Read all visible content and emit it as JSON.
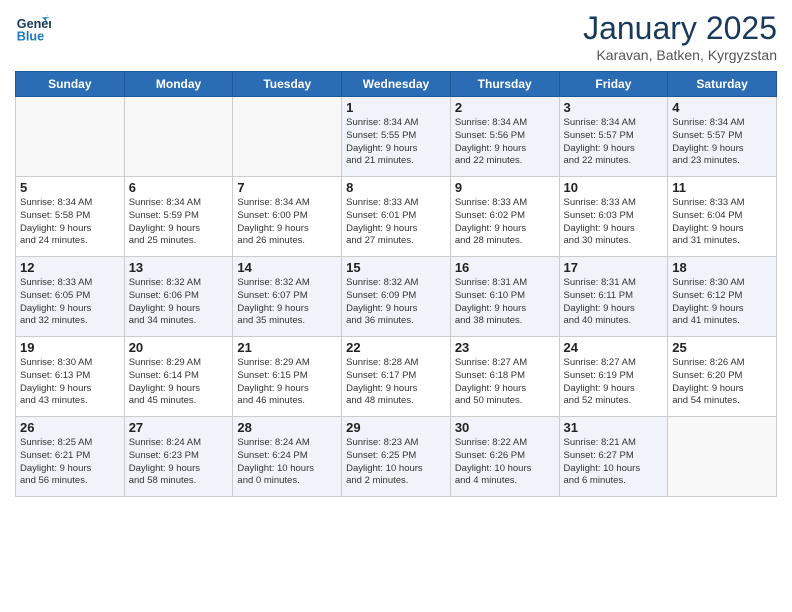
{
  "header": {
    "title": "January 2025",
    "location": "Karavan, Batken, Kyrgyzstan",
    "logo_line1": "General",
    "logo_line2": "Blue"
  },
  "weekdays": [
    "Sunday",
    "Monday",
    "Tuesday",
    "Wednesday",
    "Thursday",
    "Friday",
    "Saturday"
  ],
  "weeks": [
    [
      {
        "day": "",
        "content": ""
      },
      {
        "day": "",
        "content": ""
      },
      {
        "day": "",
        "content": ""
      },
      {
        "day": "1",
        "content": "Sunrise: 8:34 AM\nSunset: 5:55 PM\nDaylight: 9 hours\nand 21 minutes."
      },
      {
        "day": "2",
        "content": "Sunrise: 8:34 AM\nSunset: 5:56 PM\nDaylight: 9 hours\nand 22 minutes."
      },
      {
        "day": "3",
        "content": "Sunrise: 8:34 AM\nSunset: 5:57 PM\nDaylight: 9 hours\nand 22 minutes."
      },
      {
        "day": "4",
        "content": "Sunrise: 8:34 AM\nSunset: 5:57 PM\nDaylight: 9 hours\nand 23 minutes."
      }
    ],
    [
      {
        "day": "5",
        "content": "Sunrise: 8:34 AM\nSunset: 5:58 PM\nDaylight: 9 hours\nand 24 minutes."
      },
      {
        "day": "6",
        "content": "Sunrise: 8:34 AM\nSunset: 5:59 PM\nDaylight: 9 hours\nand 25 minutes."
      },
      {
        "day": "7",
        "content": "Sunrise: 8:34 AM\nSunset: 6:00 PM\nDaylight: 9 hours\nand 26 minutes."
      },
      {
        "day": "8",
        "content": "Sunrise: 8:33 AM\nSunset: 6:01 PM\nDaylight: 9 hours\nand 27 minutes."
      },
      {
        "day": "9",
        "content": "Sunrise: 8:33 AM\nSunset: 6:02 PM\nDaylight: 9 hours\nand 28 minutes."
      },
      {
        "day": "10",
        "content": "Sunrise: 8:33 AM\nSunset: 6:03 PM\nDaylight: 9 hours\nand 30 minutes."
      },
      {
        "day": "11",
        "content": "Sunrise: 8:33 AM\nSunset: 6:04 PM\nDaylight: 9 hours\nand 31 minutes."
      }
    ],
    [
      {
        "day": "12",
        "content": "Sunrise: 8:33 AM\nSunset: 6:05 PM\nDaylight: 9 hours\nand 32 minutes."
      },
      {
        "day": "13",
        "content": "Sunrise: 8:32 AM\nSunset: 6:06 PM\nDaylight: 9 hours\nand 34 minutes."
      },
      {
        "day": "14",
        "content": "Sunrise: 8:32 AM\nSunset: 6:07 PM\nDaylight: 9 hours\nand 35 minutes."
      },
      {
        "day": "15",
        "content": "Sunrise: 8:32 AM\nSunset: 6:09 PM\nDaylight: 9 hours\nand 36 minutes."
      },
      {
        "day": "16",
        "content": "Sunrise: 8:31 AM\nSunset: 6:10 PM\nDaylight: 9 hours\nand 38 minutes."
      },
      {
        "day": "17",
        "content": "Sunrise: 8:31 AM\nSunset: 6:11 PM\nDaylight: 9 hours\nand 40 minutes."
      },
      {
        "day": "18",
        "content": "Sunrise: 8:30 AM\nSunset: 6:12 PM\nDaylight: 9 hours\nand 41 minutes."
      }
    ],
    [
      {
        "day": "19",
        "content": "Sunrise: 8:30 AM\nSunset: 6:13 PM\nDaylight: 9 hours\nand 43 minutes."
      },
      {
        "day": "20",
        "content": "Sunrise: 8:29 AM\nSunset: 6:14 PM\nDaylight: 9 hours\nand 45 minutes."
      },
      {
        "day": "21",
        "content": "Sunrise: 8:29 AM\nSunset: 6:15 PM\nDaylight: 9 hours\nand 46 minutes."
      },
      {
        "day": "22",
        "content": "Sunrise: 8:28 AM\nSunset: 6:17 PM\nDaylight: 9 hours\nand 48 minutes."
      },
      {
        "day": "23",
        "content": "Sunrise: 8:27 AM\nSunset: 6:18 PM\nDaylight: 9 hours\nand 50 minutes."
      },
      {
        "day": "24",
        "content": "Sunrise: 8:27 AM\nSunset: 6:19 PM\nDaylight: 9 hours\nand 52 minutes."
      },
      {
        "day": "25",
        "content": "Sunrise: 8:26 AM\nSunset: 6:20 PM\nDaylight: 9 hours\nand 54 minutes."
      }
    ],
    [
      {
        "day": "26",
        "content": "Sunrise: 8:25 AM\nSunset: 6:21 PM\nDaylight: 9 hours\nand 56 minutes."
      },
      {
        "day": "27",
        "content": "Sunrise: 8:24 AM\nSunset: 6:23 PM\nDaylight: 9 hours\nand 58 minutes."
      },
      {
        "day": "28",
        "content": "Sunrise: 8:24 AM\nSunset: 6:24 PM\nDaylight: 10 hours\nand 0 minutes."
      },
      {
        "day": "29",
        "content": "Sunrise: 8:23 AM\nSunset: 6:25 PM\nDaylight: 10 hours\nand 2 minutes."
      },
      {
        "day": "30",
        "content": "Sunrise: 8:22 AM\nSunset: 6:26 PM\nDaylight: 10 hours\nand 4 minutes."
      },
      {
        "day": "31",
        "content": "Sunrise: 8:21 AM\nSunset: 6:27 PM\nDaylight: 10 hours\nand 6 minutes."
      },
      {
        "day": "",
        "content": ""
      }
    ]
  ]
}
